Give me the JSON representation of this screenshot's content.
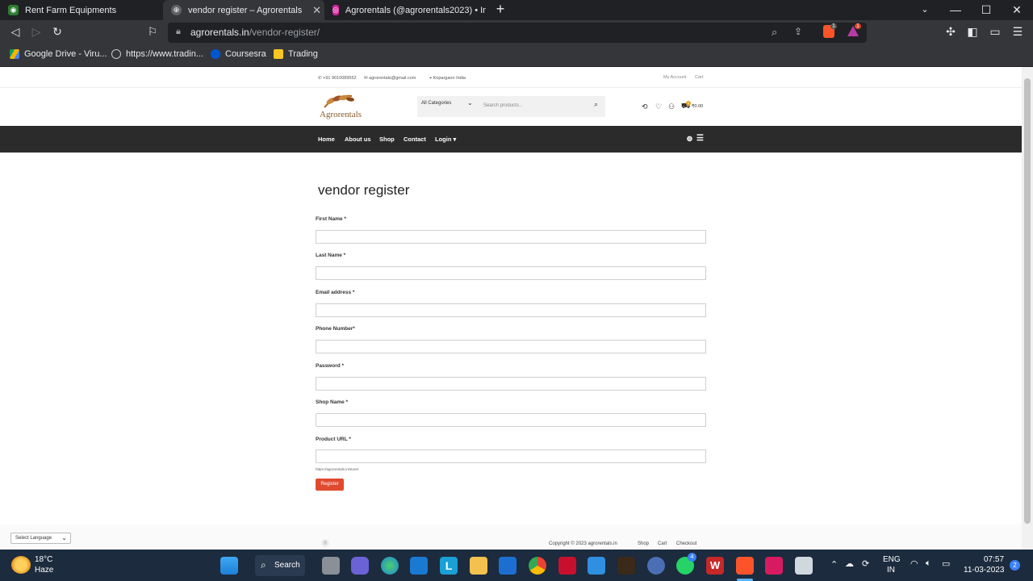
{
  "browser": {
    "tabs": [
      {
        "title": "Rent Farm Equipments",
        "active": false
      },
      {
        "title": "vendor register – Agrorentals",
        "active": true
      },
      {
        "title": "Agrorentals (@agrorentals2023) • Inst",
        "active": false
      }
    ],
    "url_domain": "agrorentals.in",
    "url_path": "/vendor-register/",
    "bookmarks": [
      "Google Drive - Viru...",
      "https://www.tradin...",
      "Coursesra",
      "Trading"
    ],
    "extension_badges": [
      "1",
      "1"
    ]
  },
  "site": {
    "phone": "+91 9010089552",
    "email": "agrorentals@gmail.com",
    "location": "Kopargaon India",
    "my_account": "My Account",
    "cart_link": "Cart",
    "logo_text": "Agrorentals",
    "category_select": "All Categories",
    "search_placeholder": "Search products...",
    "cart_amount": "₹0.00",
    "cart_count": "0",
    "nav": [
      "Home",
      "About us",
      "Shop",
      "Contact",
      "Login"
    ]
  },
  "form": {
    "title": "vendor register",
    "fields": [
      {
        "label": "First Name *"
      },
      {
        "label": "Last Name *"
      },
      {
        "label": "Email address *"
      },
      {
        "label": "Phone Number*"
      },
      {
        "label": "Password *"
      },
      {
        "label": "Shop Name *"
      },
      {
        "label": "Product URL *"
      }
    ],
    "url_hint": "https://agrorentals.in/store/",
    "submit": "Register"
  },
  "footer": {
    "language": "Select Language",
    "copyright": "Copyright © 2023 agrorentals.in",
    "links": [
      "Shop",
      "Cart",
      "Checkout"
    ]
  },
  "taskbar": {
    "weather_temp": "18°C",
    "weather_desc": "Haze",
    "search": "Search",
    "lang": "ENG",
    "region": "IN",
    "time": "07:57",
    "date": "11-03-2023",
    "notif_count": "2",
    "whatsapp_badge": "4"
  }
}
